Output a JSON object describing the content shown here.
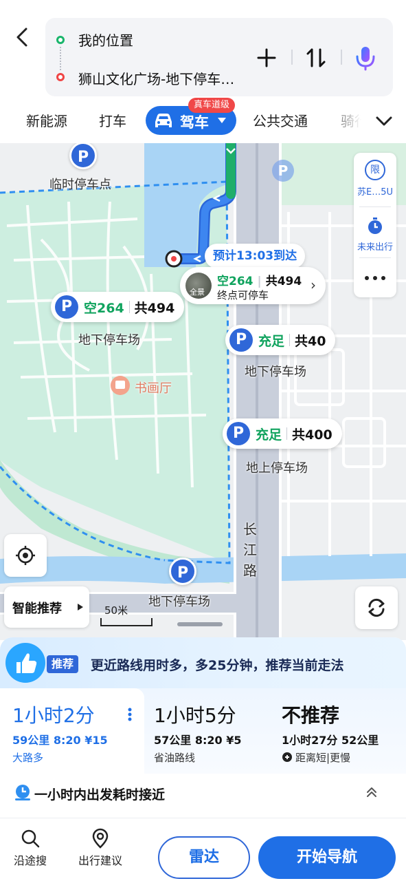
{
  "header": {
    "origin": "我的位置",
    "destination": "狮山文化广场-地下停车…",
    "icons": {
      "back": "back-arrow-icon",
      "add": "plus-icon",
      "swap": "swap-icon",
      "voice": "microphone-icon"
    }
  },
  "modes": {
    "items": [
      "新能源",
      "打车",
      "驾车",
      "公共交通",
      "骑行"
    ],
    "active": "驾车",
    "badge": "真车道级"
  },
  "map": {
    "eta": "预计13:03到达",
    "destination_card": {
      "thumb_label": "全景",
      "free": "空264",
      "total": "共494",
      "note": "终点可停车"
    },
    "labels": {
      "temp_parking": "临时停车点",
      "underground_1": "地下停车场",
      "underground_2": "地下停车场",
      "ground": "地上停车场",
      "underground_3": "地下停车场",
      "poi": "书画厅",
      "road": "长江路"
    },
    "parking_pins": [
      {
        "free": "空264",
        "total": "共494"
      },
      {
        "free": "充足",
        "total": "共40"
      },
      {
        "free": "充足",
        "total": "共400"
      }
    ],
    "side_panel": {
      "plate": "苏E…5U",
      "plate_icon_text": "限",
      "future": "未来出行"
    },
    "smart_recommend": "智能推荐",
    "scale": "50米"
  },
  "sheet": {
    "tip_tag": "推荐",
    "tip_message": "更近路线用时多，多25分钟，推荐当前走法",
    "plans": [
      {
        "time": "1小时2分",
        "detail": "59公里 8:20 ¥15",
        "note": "大路多"
      },
      {
        "time": "1小时5分",
        "detail": "57公里 8:20 ¥5",
        "note": "省油路线"
      },
      {
        "time": "不推荐",
        "detail": "1小时27分 52公里",
        "note": "距离短|更慢"
      }
    ],
    "departure": "一小时内出发耗时接近",
    "actions": [
      {
        "label": "沿途搜",
        "icon": "search-icon"
      },
      {
        "label": "出行建议",
        "icon": "location-pin-icon"
      }
    ],
    "radar_button": "雷达",
    "start_button": "开始导航"
  },
  "colors": {
    "accent": "#1f6fe6",
    "route": "#3d86f0",
    "free": "#10a35e",
    "badge": "#f04848"
  }
}
